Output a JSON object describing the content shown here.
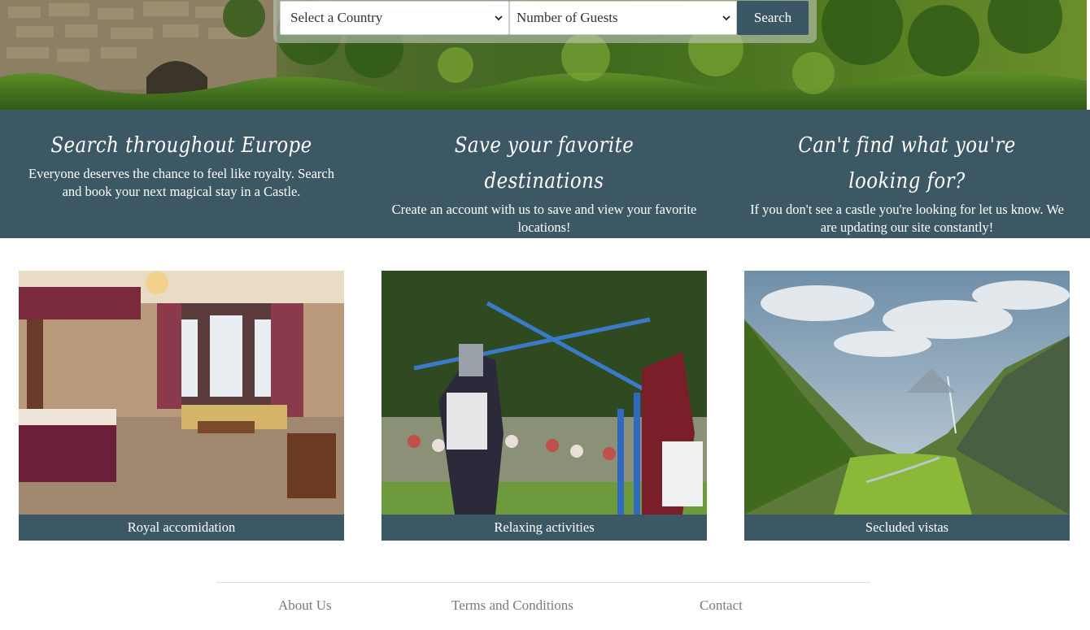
{
  "search": {
    "country_selected": "Select a Country",
    "guests_selected": "Number of Guests",
    "button_label": "Search"
  },
  "features": [
    {
      "title": "Search throughout Europe",
      "text": "Everyone deserves the chance to feel like royalty. Search and book your next magical stay in a Castle."
    },
    {
      "title": "Save your favorite destinations",
      "text": "Create an account with us to save and view your favorite locations!"
    },
    {
      "title": "Can't find what you're looking for?",
      "text": "If you don't see a castle you're looking for let us know. We are updating our site constantly!"
    }
  ],
  "cards": [
    {
      "caption": "Royal accomidation"
    },
    {
      "caption": "Relaxing activities"
    },
    {
      "caption": "Secluded vistas"
    }
  ],
  "footer": {
    "links": [
      "About Us",
      "Terms and Conditions",
      "Contact"
    ]
  },
  "colors": {
    "accent": "#3c5865",
    "footer_text": "#7a7a7a"
  }
}
